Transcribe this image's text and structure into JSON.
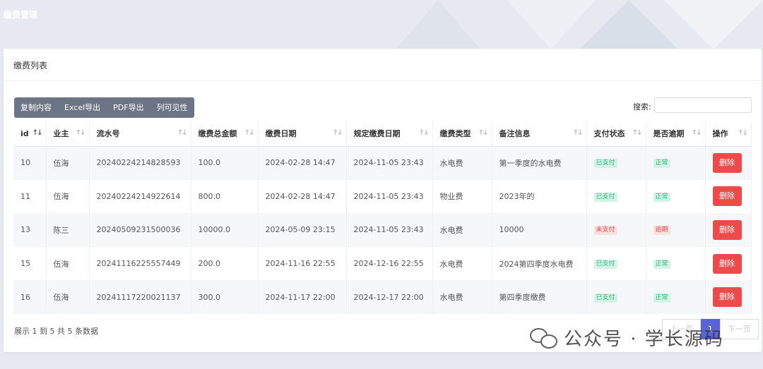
{
  "page_title": "缴费管理",
  "card_title": "缴费列表",
  "toolbar": [
    "复制内容",
    "Excel导出",
    "PDF导出",
    "列可见性"
  ],
  "search_label": "搜索:",
  "search_value": "",
  "columns": [
    "id",
    "业主",
    "流水号",
    "缴费总金额",
    "缴费日期",
    "规定缴费日期",
    "缴费类型",
    "备注信息",
    "支付状态",
    "是否逾期",
    "操作"
  ],
  "rows": [
    {
      "id": "10",
      "owner": "伍海",
      "serial": "20240224214828593",
      "amount": "100.0",
      "pay_date": "2024-02-28 14:47",
      "due_date": "2024-11-05 23:43",
      "type": "水电费",
      "note": "第一季度的水电费",
      "status": "已支付",
      "overdue": "正常",
      "action": "删除"
    },
    {
      "id": "11",
      "owner": "伍海",
      "serial": "20240224214922614",
      "amount": "800.0",
      "pay_date": "2024-02-28 14:47",
      "due_date": "2024-11-05 23:43",
      "type": "物业费",
      "note": "2023年的",
      "status": "已支付",
      "overdue": "正常",
      "action": "删除"
    },
    {
      "id": "13",
      "owner": "陈三",
      "serial": "20240509231500036",
      "amount": "10000.0",
      "pay_date": "2024-05-09 23:15",
      "due_date": "2024-11-05 23:43",
      "type": "水电费",
      "note": "10000",
      "status": "未支付",
      "overdue": "逾期",
      "action": "删除"
    },
    {
      "id": "15",
      "owner": "伍海",
      "serial": "20241116225557449",
      "amount": "200.0",
      "pay_date": "2024-11-16 22:55",
      "due_date": "2024-12-16 22:55",
      "type": "水电费",
      "note": "2024第四季度水电费",
      "status": "已支付",
      "overdue": "正常",
      "action": "删除"
    },
    {
      "id": "16",
      "owner": "伍海",
      "serial": "20241117220021137",
      "amount": "300.0",
      "pay_date": "2024-11-17 22:00",
      "due_date": "2024-12-17 22:00",
      "type": "水电费",
      "note": "第四季度缴费",
      "status": "已支付",
      "overdue": "正常",
      "action": "删除"
    }
  ],
  "info_text": "展示 1 到 5 共 5 条数据",
  "pager": {
    "prev": "上一页",
    "current": "1",
    "next": "下一页"
  },
  "watermark": "公众号 · 学长源码",
  "colors": {
    "accent": "#5a64d8",
    "danger": "#ef4a4a",
    "toolbar": "#6c7586",
    "success": "#2db67c"
  }
}
